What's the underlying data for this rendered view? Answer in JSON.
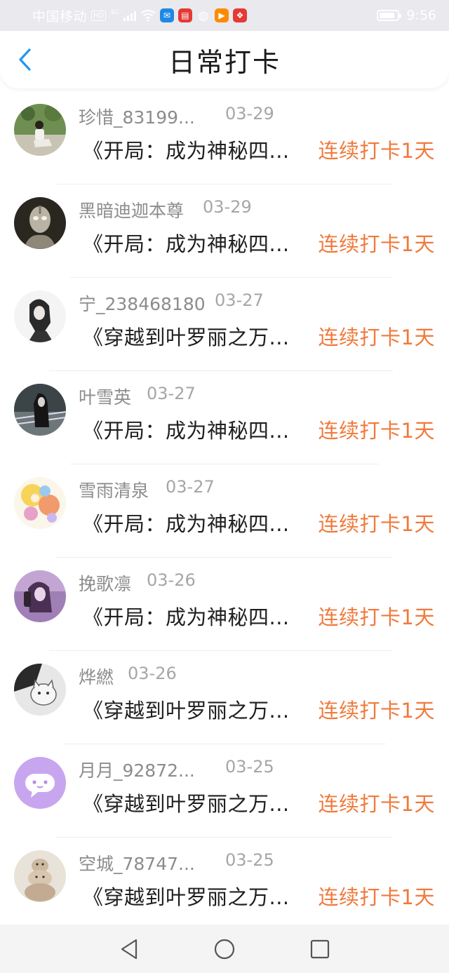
{
  "status_bar": {
    "carrier": "中国移动",
    "hd_badge": "HD",
    "network": "4G",
    "time": "9:56",
    "battery_level": 0.85,
    "apps": [
      {
        "icon": "qq-icon",
        "color": "#1e88e5",
        "glyph": "✉"
      },
      {
        "icon": "book-app-icon",
        "color": "#e53935",
        "glyph": "▤"
      },
      {
        "icon": "wechat-icon",
        "color": "#ffffff",
        "glyph": "◍"
      },
      {
        "icon": "video-app-icon",
        "color": "#fb8c00",
        "glyph": "▶"
      },
      {
        "icon": "gift-app-icon",
        "color": "#e53935",
        "glyph": "❖"
      }
    ]
  },
  "header": {
    "title": "日常打卡",
    "back_icon": "chevron-left-icon",
    "accent": "#2196f3"
  },
  "colors": {
    "streak": "#f07a3c",
    "name": "#8c8c8c",
    "date": "#a6a6a6",
    "book": "#1f1f1f"
  },
  "checkins": [
    {
      "name": "珍惜_83199...",
      "date": "03-29",
      "book": "《开局：成为神秘四...",
      "streak": "连续打卡1天",
      "avatar": "avatar-photo-person-icon"
    },
    {
      "name": "黑暗迪迦本尊",
      "date": "03-29",
      "book": "《开局：成为神秘四...",
      "streak": "连续打卡1天",
      "avatar": "avatar-ultraman-icon"
    },
    {
      "name": "宁_238468180",
      "date": "03-27",
      "book": "《穿越到叶罗丽之万...",
      "streak": "连续打卡1天",
      "avatar": "avatar-sketch-girl-icon"
    },
    {
      "name": "叶雪英",
      "date": "03-27",
      "book": "《开局：成为神秘四...",
      "streak": "连续打卡1天",
      "avatar": "avatar-dark-girl-icon"
    },
    {
      "name": "雪雨清泉",
      "date": "03-27",
      "book": "《开局：成为神秘四...",
      "streak": "连续打卡1天",
      "avatar": "avatar-anime-icon"
    },
    {
      "name": "挽歌凛",
      "date": "03-26",
      "book": "《开局：成为神秘四...",
      "streak": "连续打卡1天",
      "avatar": "avatar-purple-girl-icon"
    },
    {
      "name": "烨繎",
      "date": "03-26",
      "book": "《穿越到叶罗丽之万...",
      "streak": "连续打卡1天",
      "avatar": "avatar-cat-sketch-icon"
    },
    {
      "name": "月月_92872...",
      "date": "03-25",
      "book": "《穿越到叶罗丽之万...",
      "streak": "连续打卡1天",
      "avatar": "avatar-chat-bubble-icon"
    },
    {
      "name": "空城_78747...",
      "date": "03-25",
      "book": "《穿越到叶罗丽之万...",
      "streak": "连续打卡1天",
      "avatar": "avatar-hamsters-icon"
    }
  ],
  "nav_bar": {
    "back": "nav-back-triangle-icon",
    "home": "nav-home-circle-icon",
    "recents": "nav-recents-square-icon"
  }
}
